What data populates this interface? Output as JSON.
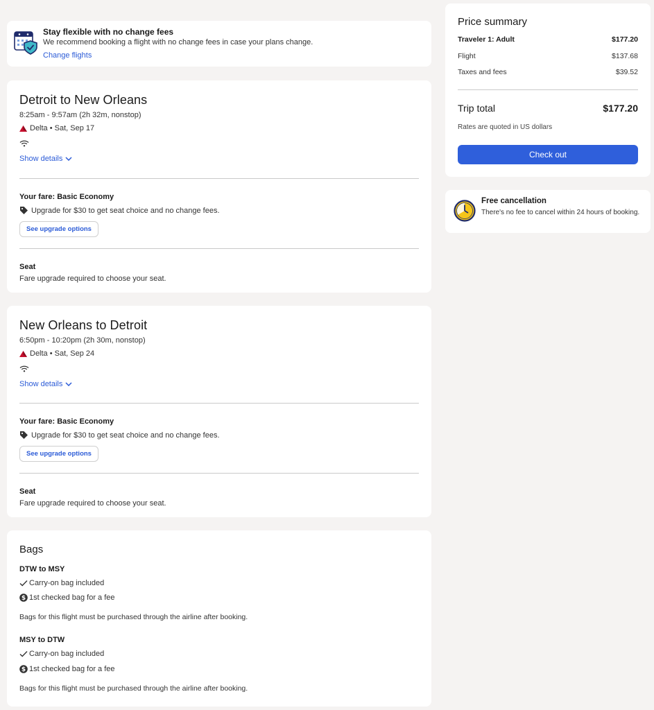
{
  "banner": {
    "title": "Stay flexible with no change fees",
    "description": "We recommend booking a flight with no change fees in case your plans change.",
    "link": "Change flights",
    "icon": "calendar-shield-icon"
  },
  "flights": [
    {
      "title": "Detroit to New Orleans",
      "times": "8:25am - 9:57am (2h 32m, nonstop)",
      "airline": "Delta • Sat, Sep 17",
      "show_details": "Show details",
      "fare_title": "Your fare: Basic Economy",
      "upgrade_text": "Upgrade for $30 to get seat choice and no change fees.",
      "upgrade_button": "See upgrade options",
      "seat_title": "Seat",
      "seat_desc": "Fare upgrade required to choose your seat."
    },
    {
      "title": "New Orleans to Detroit",
      "times": "6:50pm - 10:20pm (2h 30m, nonstop)",
      "airline": "Delta • Sat, Sep 24",
      "show_details": "Show details",
      "fare_title": "Your fare: Basic Economy",
      "upgrade_text": "Upgrade for $30 to get seat choice and no change fees.",
      "upgrade_button": "See upgrade options",
      "seat_title": "Seat",
      "seat_desc": "Fare upgrade required to choose your seat."
    }
  ],
  "bags": {
    "title": "Bags",
    "routes": [
      {
        "route": "DTW to MSY",
        "carry_on": "Carry-on bag included",
        "checked": "1st checked bag for a fee",
        "note": "Bags for this flight must be purchased through the airline after booking."
      },
      {
        "route": "MSY to DTW",
        "carry_on": "Carry-on bag included",
        "checked": "1st checked bag for a fee",
        "note": "Bags for this flight must be purchased through the airline after booking."
      }
    ]
  },
  "price": {
    "title": "Price summary",
    "traveler_label": "Traveler 1: Adult",
    "traveler_amount": "$177.20",
    "flight_label": "Flight",
    "flight_amount": "$137.68",
    "taxes_label": "Taxes and fees",
    "taxes_amount": "$39.52",
    "total_label": "Trip total",
    "total_amount": "$177.20",
    "quote_note": "Rates are quoted in US dollars",
    "checkout": "Check out"
  },
  "free_cancellation": {
    "title": "Free cancellation",
    "description": "There's no fee to cancel within 24 hours of booking.",
    "icon": "clock-icon"
  },
  "colors": {
    "background": "#f5f3f2",
    "link": "#2b5bd7",
    "checkout_button": "#2f5fdb",
    "delta_logo": "#c8102e"
  }
}
